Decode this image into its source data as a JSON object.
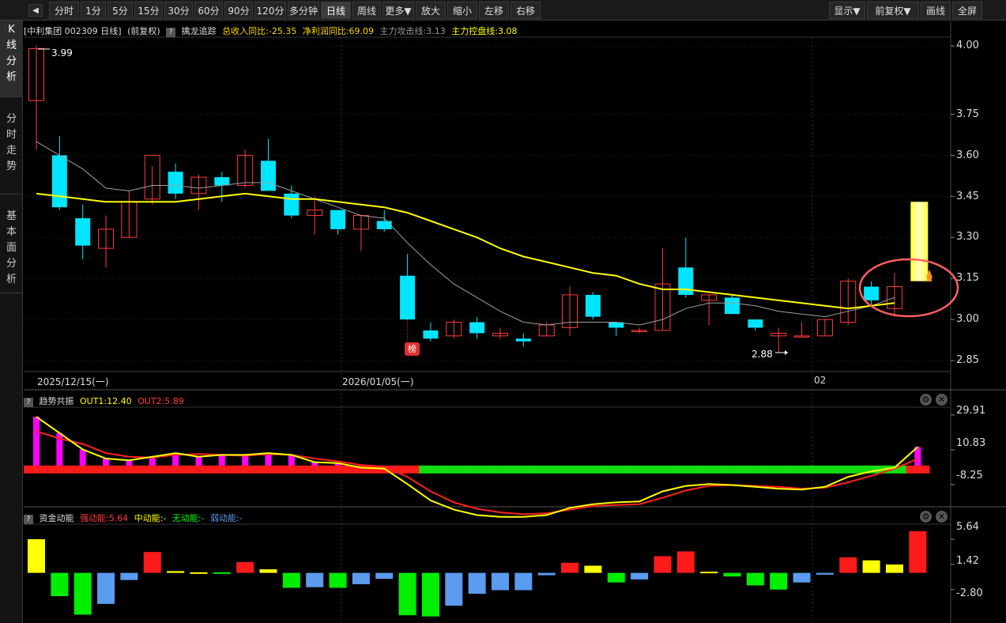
{
  "toolbar": {
    "items": [
      "分时",
      "1分",
      "5分",
      "15分",
      "30分",
      "60分",
      "90分",
      "120分",
      "多分钟",
      "日线",
      "周线",
      "更多▼",
      "放大",
      "缩小",
      "左移",
      "右移"
    ],
    "right_items": [
      "显示▼",
      "前复权▼",
      "画线",
      "全屏"
    ],
    "active": "日线"
  },
  "sidebar": {
    "tabs": [
      {
        "label": "K线分析",
        "chars": [
          "K",
          "线",
          "分",
          "析"
        ]
      },
      {
        "label": "分时走势",
        "chars": [
          "分",
          "时",
          "走",
          "势"
        ]
      },
      {
        "label": "基本面分析",
        "chars": [
          "基",
          "本",
          "面",
          "分",
          "析"
        ]
      }
    ]
  },
  "main_header": {
    "stock": "[中利集团 002309 日线]",
    "adjust": "(前复权)",
    "indicator": "擒龙追踪",
    "revenue": "总收入同比:-25.35",
    "profit": "净利润同比:69.09",
    "attack": "主力攻击线:3.13",
    "control": "主力控盘线:3.08"
  },
  "price_axis": [
    "4.00",
    "3.75",
    "3.60",
    "3.45",
    "3.30",
    "3.15",
    "3.00",
    "2.85"
  ],
  "date_labels": [
    "2025/12/15(一)",
    "2026/01/05(一)",
    "02"
  ],
  "annotations": {
    "high": "3.99",
    "low": "2.88",
    "badge": "榜"
  },
  "trend_panel": {
    "title": "趋势共振",
    "out1": "OUT1:12.40",
    "out2": "OUT2:5.89",
    "axis": [
      "29.91",
      "10.83",
      "-8.25"
    ]
  },
  "money_panel": {
    "title": "资金动能",
    "strong": "强动能:5.64",
    "medium": "中动能:-",
    "none": "无动能:-",
    "weak": "弱动能:-",
    "axis": [
      "5.64",
      "1.42",
      "-2.80"
    ]
  },
  "colors": {
    "up": "#ff3b3b",
    "down": "#00e5ff",
    "ma_yellow": "#ffff00",
    "ma_gray": "#a0a0a0",
    "green": "#00ff00",
    "magenta": "#ff00ff",
    "blue": "#5b9bf0",
    "accent": "#ff6060"
  },
  "chart_data": [
    {
      "type": "candlestick",
      "title": "中利集团 002309 日线",
      "candles": [
        {
          "o": 3.8,
          "h": 4.0,
          "l": 3.62,
          "c": 3.99
        },
        {
          "o": 3.6,
          "h": 3.67,
          "l": 3.4,
          "c": 3.41
        },
        {
          "o": 3.37,
          "h": 3.42,
          "l": 3.22,
          "c": 3.27
        },
        {
          "o": 3.26,
          "h": 3.38,
          "l": 3.19,
          "c": 3.33
        },
        {
          "o": 3.3,
          "h": 3.47,
          "l": 3.3,
          "c": 3.43
        },
        {
          "o": 3.44,
          "h": 3.56,
          "l": 3.42,
          "c": 3.6
        },
        {
          "o": 3.54,
          "h": 3.57,
          "l": 3.44,
          "c": 3.46
        },
        {
          "o": 3.46,
          "h": 3.53,
          "l": 3.4,
          "c": 3.52
        },
        {
          "o": 3.52,
          "h": 3.54,
          "l": 3.43,
          "c": 3.49
        },
        {
          "o": 3.49,
          "h": 3.62,
          "l": 3.48,
          "c": 3.6
        },
        {
          "o": 3.58,
          "h": 3.66,
          "l": 3.47,
          "c": 3.47
        },
        {
          "o": 3.46,
          "h": 3.49,
          "l": 3.37,
          "c": 3.38
        },
        {
          "o": 3.38,
          "h": 3.45,
          "l": 3.31,
          "c": 3.4
        },
        {
          "o": 3.4,
          "h": 3.4,
          "l": 3.31,
          "c": 3.33
        },
        {
          "o": 3.33,
          "h": 3.38,
          "l": 3.25,
          "c": 3.38
        },
        {
          "o": 3.36,
          "h": 3.4,
          "l": 3.32,
          "c": 3.33
        },
        {
          "o": 3.16,
          "h": 3.24,
          "l": 3.0,
          "c": 3.0
        },
        {
          "o": 2.96,
          "h": 2.99,
          "l": 2.92,
          "c": 2.93
        },
        {
          "o": 2.94,
          "h": 3.0,
          "l": 2.93,
          "c": 2.99
        },
        {
          "o": 2.99,
          "h": 3.01,
          "l": 2.93,
          "c": 2.95
        },
        {
          "o": 2.94,
          "h": 2.97,
          "l": 2.93,
          "c": 2.95
        },
        {
          "o": 2.93,
          "h": 2.95,
          "l": 2.9,
          "c": 2.92
        },
        {
          "o": 2.94,
          "h": 2.99,
          "l": 2.94,
          "c": 2.98
        },
        {
          "o": 2.97,
          "h": 3.12,
          "l": 2.94,
          "c": 3.09
        },
        {
          "o": 3.09,
          "h": 3.1,
          "l": 3.0,
          "c": 3.01
        },
        {
          "o": 2.99,
          "h": 2.99,
          "l": 2.94,
          "c": 2.97
        },
        {
          "o": 2.96,
          "h": 2.97,
          "l": 2.95,
          "c": 2.96
        },
        {
          "o": 2.96,
          "h": 3.26,
          "l": 2.96,
          "c": 3.13
        },
        {
          "o": 3.19,
          "h": 3.3,
          "l": 3.08,
          "c": 3.09
        },
        {
          "o": 3.07,
          "h": 3.09,
          "l": 2.98,
          "c": 3.09
        },
        {
          "o": 3.08,
          "h": 3.09,
          "l": 3.02,
          "c": 3.02
        },
        {
          "o": 3.0,
          "h": 3.0,
          "l": 2.96,
          "c": 2.97
        },
        {
          "o": 2.94,
          "h": 2.97,
          "l": 2.88,
          "c": 2.95
        },
        {
          "o": 2.94,
          "h": 2.99,
          "l": 2.94,
          "c": 2.94
        },
        {
          "o": 2.94,
          "h": 3.0,
          "l": 2.94,
          "c": 3.0
        },
        {
          "o": 2.99,
          "h": 3.15,
          "l": 2.98,
          "c": 3.14
        },
        {
          "o": 3.12,
          "h": 3.14,
          "l": 3.05,
          "c": 3.07
        },
        {
          "o": 3.04,
          "h": 3.17,
          "l": 3.01,
          "c": 3.12
        }
      ],
      "ma_yellow": [
        3.46,
        3.45,
        3.44,
        3.43,
        3.43,
        3.43,
        3.43,
        3.44,
        3.45,
        3.46,
        3.45,
        3.44,
        3.44,
        3.43,
        3.42,
        3.41,
        3.39,
        3.36,
        3.33,
        3.3,
        3.26,
        3.23,
        3.21,
        3.19,
        3.17,
        3.16,
        3.13,
        3.11,
        3.11,
        3.1,
        3.09,
        3.08,
        3.07,
        3.06,
        3.05,
        3.04,
        3.05,
        3.06
      ],
      "ma_gray": [
        3.65,
        3.6,
        3.55,
        3.48,
        3.47,
        3.49,
        3.49,
        3.48,
        3.49,
        3.5,
        3.5,
        3.47,
        3.44,
        3.41,
        3.38,
        3.37,
        3.28,
        3.2,
        3.13,
        3.08,
        3.03,
        2.99,
        2.98,
        2.99,
        2.99,
        2.99,
        2.98,
        3.0,
        3.04,
        3.06,
        3.06,
        3.05,
        3.03,
        3.02,
        3.01,
        3.03,
        3.05,
        3.08
      ],
      "attack_bar": {
        "from": 3.14,
        "to": 3.43
      },
      "ylim": [
        2.85,
        4.0
      ]
    },
    {
      "type": "bar",
      "title": "趋势共振",
      "series": [
        {
          "name": "OUT1",
          "values": [
            28.9,
            20.0,
            11.0,
            6.0,
            5.0,
            7.0,
            9.0,
            7.0,
            8.0,
            8.0,
            9.0,
            8.0,
            4.0,
            3.5,
            1.0,
            0.5,
            -8.0,
            -17.0,
            -22.0,
            -25.0,
            -26.0,
            -26.0,
            -25.0,
            -21.0,
            -19.0,
            -18.0,
            -17.5,
            -12.0,
            -9.0,
            -8.0,
            -8.5,
            -9.5,
            -10.5,
            -11.0,
            -9.5,
            -4.0,
            -1.0,
            1.0,
            12.4
          ]
        },
        {
          "name": "OUT2",
          "values": [
            21.0,
            17.0,
            14.0,
            9.0,
            7.0,
            6.5,
            8.0,
            8.5,
            8.0,
            7.5,
            8.5,
            8.0,
            6.0,
            4.5,
            2.5,
            1.5,
            -4.0,
            -12.0,
            -18.0,
            -21.5,
            -23.5,
            -24.5,
            -24.0,
            -22.0,
            -20.0,
            -19.5,
            -19.0,
            -15.5,
            -11.5,
            -9.0,
            -8.5,
            -9.0,
            -9.5,
            -10.5,
            -10.0,
            -7.0,
            -3.5,
            0.5,
            5.89
          ]
        }
      ],
      "bars": [
        28.9,
        20.0,
        11.0,
        6.0,
        5.0,
        7.0,
        9.0,
        7.0,
        8.0,
        8.0,
        9.0,
        8.0,
        4.0,
        3.5,
        1.0,
        0.5,
        -8.0,
        -17.0,
        -22.0,
        -25.0,
        -26.0,
        -26.0,
        -25.0,
        -21.0,
        -19.0,
        -18.0,
        -17.5,
        -12.0,
        -9.0,
        -8.0,
        -8.5,
        -9.5,
        -10.5,
        -11.0,
        -9.5,
        -4.0,
        -1.0,
        1.0,
        12.4
      ],
      "band": [
        "red",
        "red",
        "red",
        "red",
        "red",
        "red",
        "red",
        "red",
        "red",
        "red",
        "red",
        "red",
        "red",
        "red",
        "red",
        "red",
        "red",
        "green",
        "green",
        "green",
        "green",
        "green",
        "green",
        "green",
        "green",
        "green",
        "green",
        "green",
        "green",
        "green",
        "green",
        "green",
        "green",
        "green",
        "green",
        "green",
        "green",
        "green",
        "red"
      ],
      "ylim": [
        -20,
        32
      ]
    },
    {
      "type": "bar",
      "title": "资金动能",
      "values": [
        5.64,
        -3.9,
        -7.0,
        -5.2,
        -1.2,
        3.5,
        0.3,
        0.1,
        0.1,
        1.8,
        0.6,
        -2.5,
        -2.4,
        -2.5,
        -1.9,
        -1.0,
        -7.1,
        -7.3,
        -5.5,
        -3.5,
        -2.9,
        -2.9,
        -0.4,
        1.7,
        1.2,
        -1.6,
        -1.1,
        2.8,
        3.6,
        0.2,
        -0.6,
        -2.1,
        -2.8,
        -1.6,
        -0.3,
        2.6,
        2.1,
        1.4,
        7.0
      ],
      "kinds": [
        "yellow",
        "green",
        "green",
        "blue",
        "blue",
        "red",
        "yellow",
        "yellow",
        "green",
        "red",
        "yellow",
        "green",
        "blue",
        "green",
        "blue",
        "blue",
        "green",
        "green",
        "blue",
        "blue",
        "blue",
        "blue",
        "blue",
        "red",
        "yellow",
        "green",
        "blue",
        "red",
        "red",
        "yellow",
        "green",
        "green",
        "green",
        "blue",
        "blue",
        "red",
        "yellow",
        "yellow",
        "red"
      ],
      "ylim": [
        -8.4,
        7.5
      ]
    }
  ]
}
